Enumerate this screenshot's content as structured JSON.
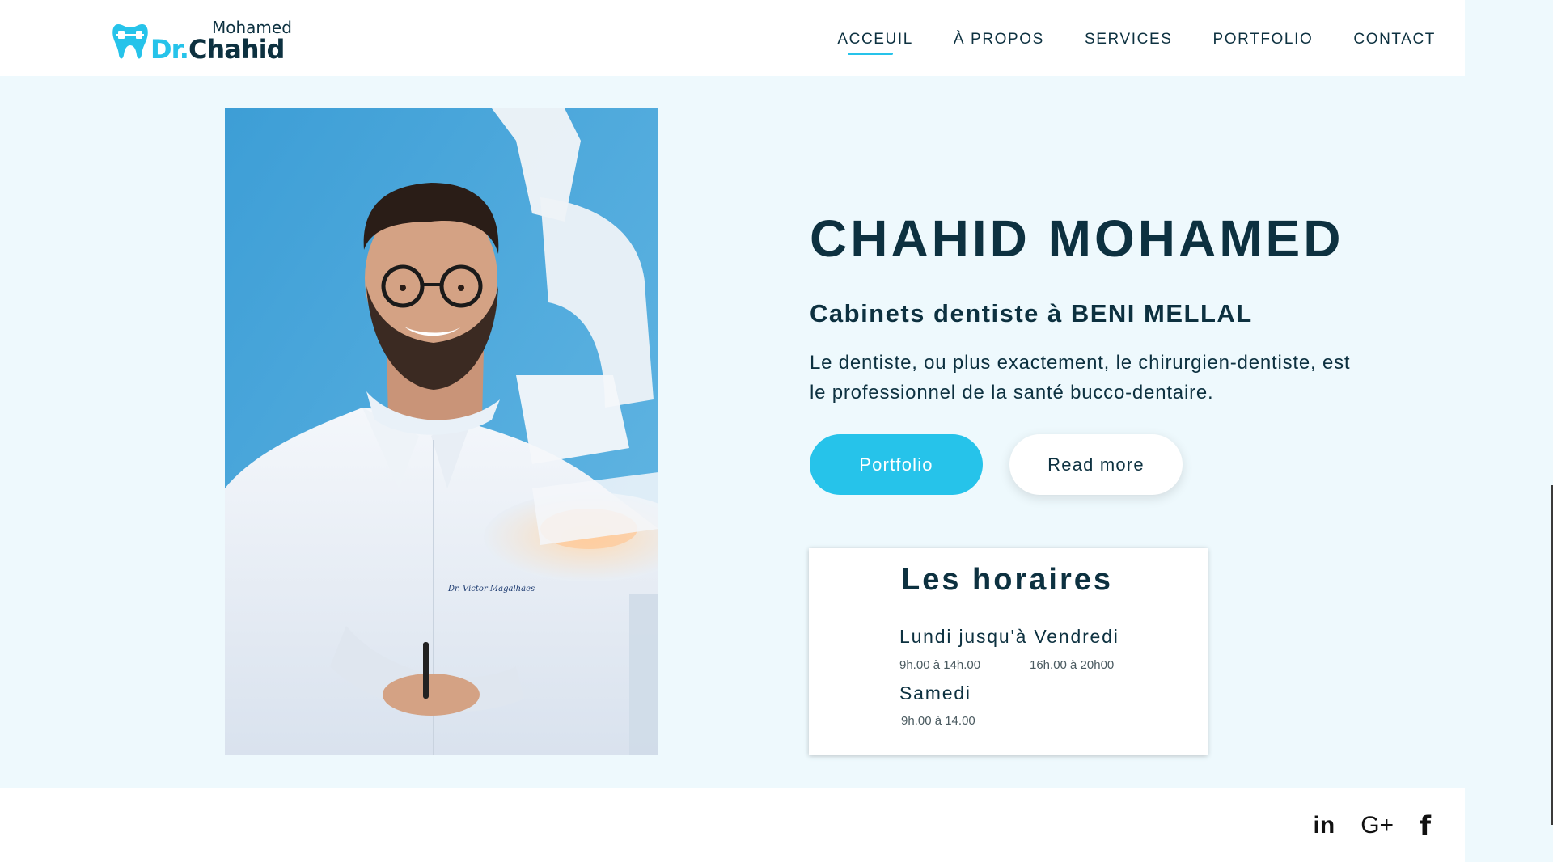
{
  "brand": {
    "small": "Mohamed",
    "prefix": "Dr.",
    "name": "Chahid",
    "colors": {
      "accent": "#26c3ea",
      "dark": "#0d3140"
    }
  },
  "nav": {
    "items": [
      {
        "label": "ACCEUIL",
        "active": true
      },
      {
        "label": "À PROPOS",
        "active": false
      },
      {
        "label": "SERVICES",
        "active": false
      },
      {
        "label": "PORTFOLIO",
        "active": false
      },
      {
        "label": "CONTACT",
        "active": false
      }
    ]
  },
  "hero": {
    "title": "CHAHID MOHAMED",
    "subtitle": "Cabinets dentiste à BENI MELLAL",
    "description": "Le dentiste, ou plus exactement, le chirurgien-dentiste, est le professionnel de la santé bucco-dentaire.",
    "photo_badge": "Dr. Victor Magalhães",
    "buttons": {
      "primary": "Portfolio",
      "secondary": "Read more"
    }
  },
  "hours": {
    "title": "Les horaires",
    "weekday_label": "Lundi jusqu'à Vendredi",
    "weekday_morning": "9h.00 à 14h.00",
    "weekday_evening": "16h.00 à 20h00",
    "saturday_label": "Samedi",
    "saturday_time": "9h.00 à 14.00"
  },
  "footer": {
    "social": [
      {
        "icon": "linkedin-icon",
        "glyph": "in"
      },
      {
        "icon": "google-plus-icon",
        "glyph": "G+"
      },
      {
        "icon": "facebook-icon",
        "glyph": "f"
      }
    ]
  }
}
